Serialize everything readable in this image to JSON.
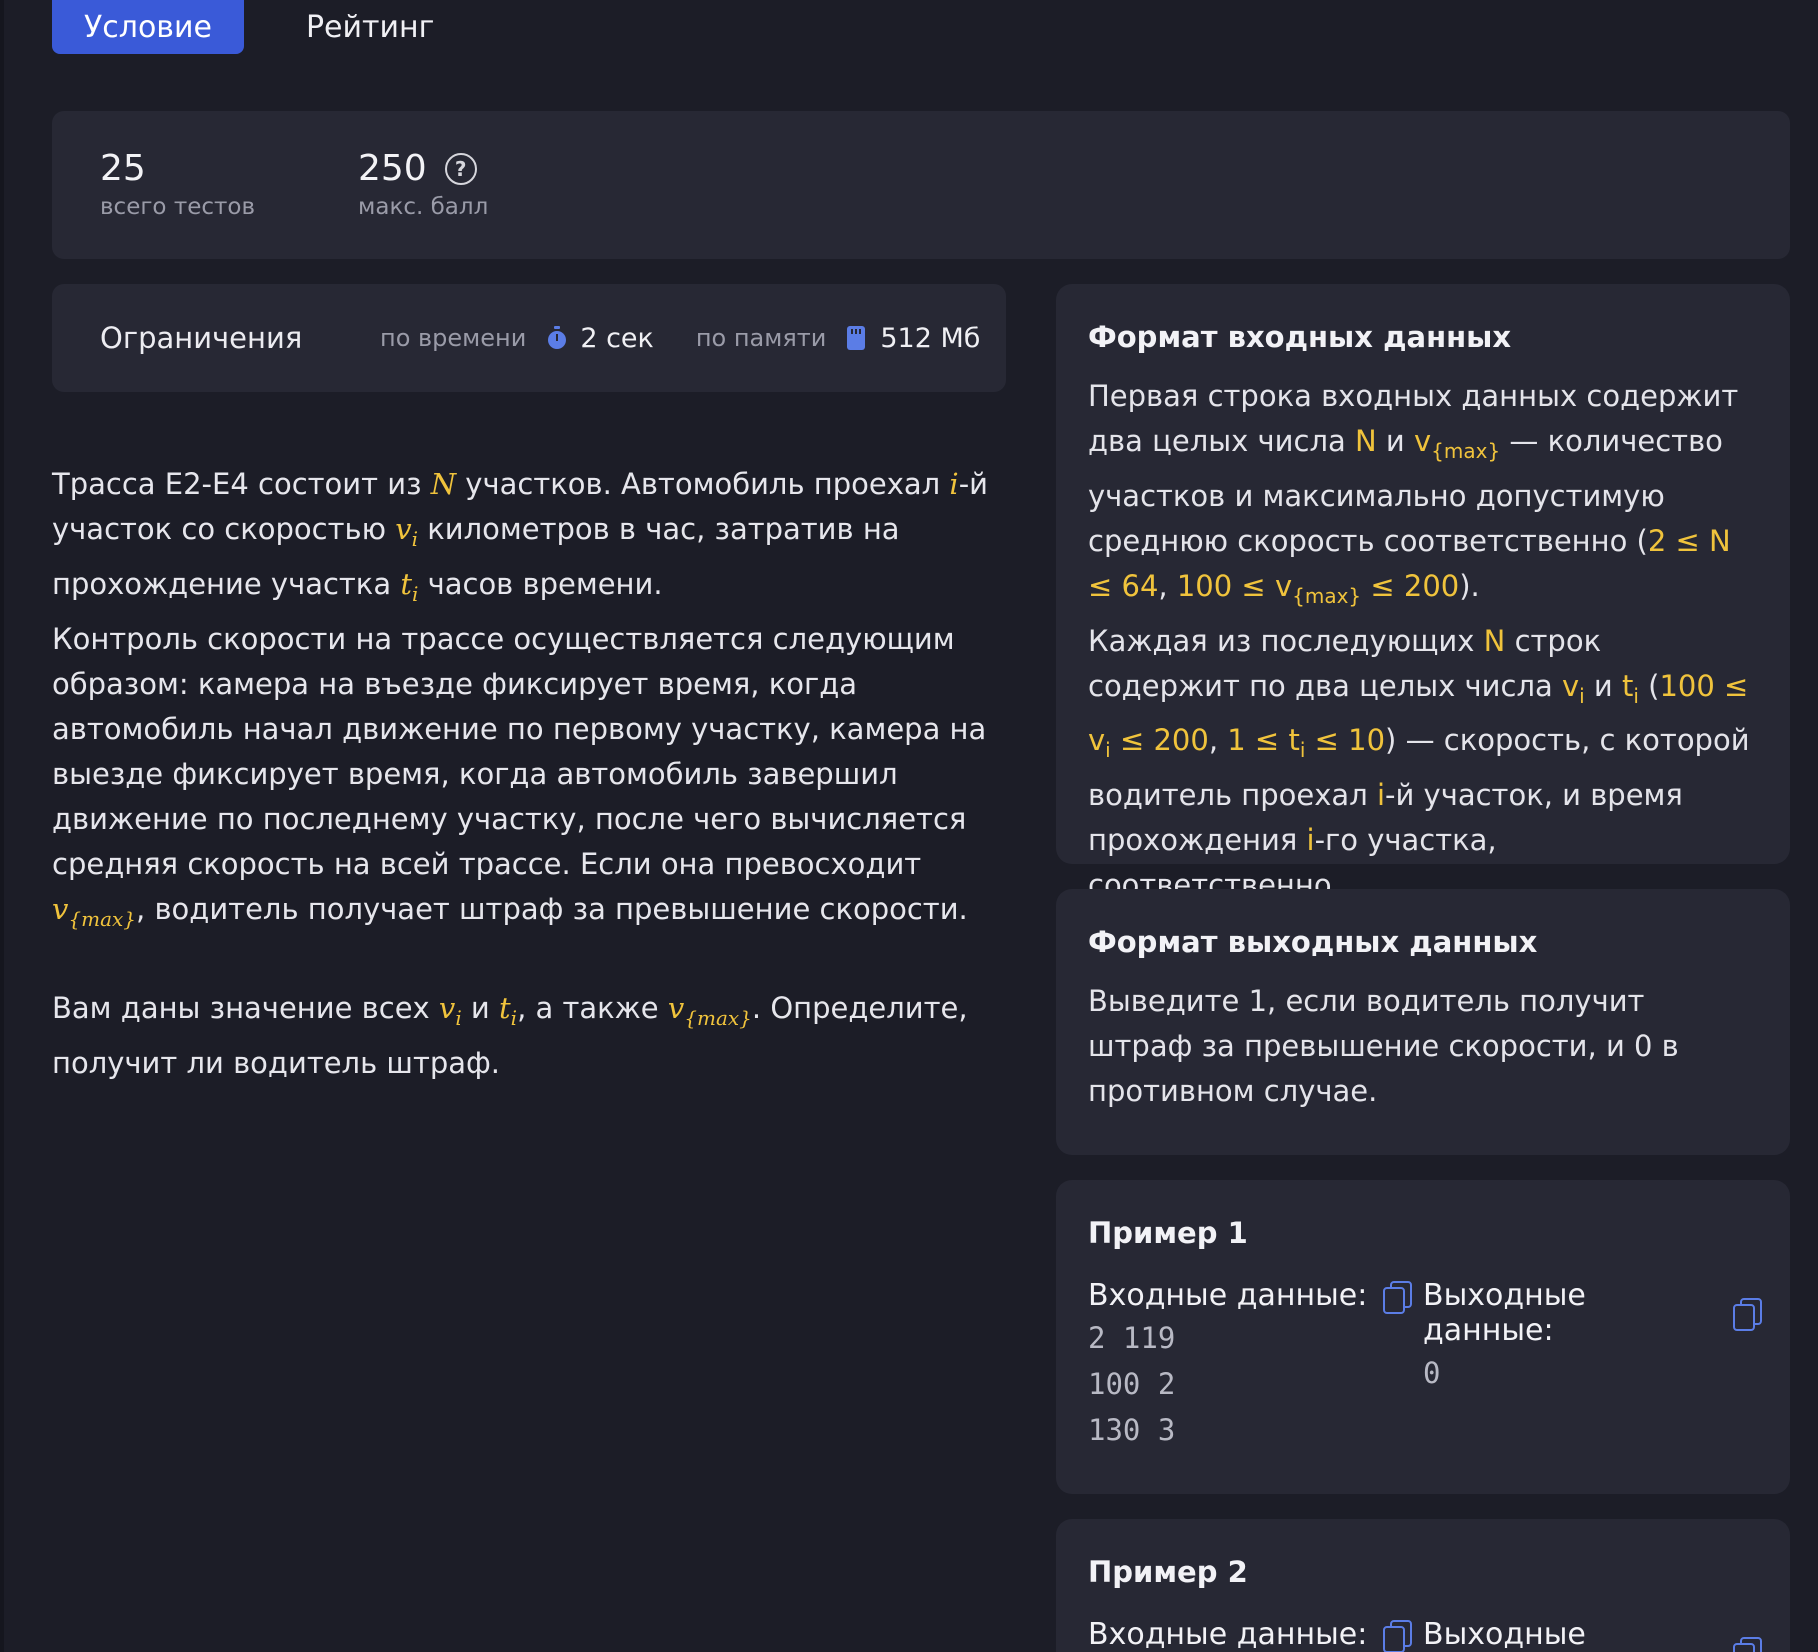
{
  "tabs": {
    "condition": "Условие",
    "rating": "Рейтинг"
  },
  "stats": {
    "tests_value": "25",
    "tests_label": "всего тестов",
    "score_value": "250",
    "score_label": "макс. балл"
  },
  "limits": {
    "title": "Ограничения",
    "time_label": "по времени",
    "time_value": "2 сек",
    "memory_label": "по памяти",
    "memory_value": "512 Мб"
  },
  "statement": {
    "p1_a": "Трасса E2-E4 состоит из ",
    "var_N": "N",
    "p1_b": " участков. Автомобиль проехал ",
    "var_i": "i",
    "p1_c": "-й участок со скоростью ",
    "var_v": "v",
    "sub_i": "i",
    "p1_d": " километров в час, затратив на прохождение участка ",
    "var_t": "t",
    "p1_e": " часов времени.",
    "p2_a": "Контроль скорости на трассе осуществляется следующим образом: камера на въезде фиксирует время, когда автомобиль начал движение по первому участку, камера на выезде фиксирует время, когда автомобиль завершил движение по последнему участку, после чего вычисляется средняя скорость на всей трассе. Если она превосходит ",
    "sub_max": "{max}",
    "p2_b": ", водитель получает штраф за превышение скорости.",
    "p3_a": "Вам даны значение всех ",
    "p3_b": " и ",
    "p3_c": ", а также ",
    "p3_d": ". Определите, получит ли водитель штраф."
  },
  "input_format": {
    "title": "Формат входных данных",
    "s1": "Первая строка входных данных содержит два целых числа ",
    "N": "N",
    "and": " и ",
    "v": "v",
    "sub_max": "{max}",
    "s2": " — количество участков и максимально допустимую среднюю скорость соответственно (",
    "c1": "2 ≤ N ≤ 64",
    "comma": ", ",
    "c2a": "100 ≤ v",
    "c2b": " ≤ 200",
    "s3": ").",
    "s4": "Каждая из последующих ",
    "s5": " строк содержит по два целых числа ",
    "sub_i": "i",
    "t": "t",
    "s6": " (",
    "c3a": "100 ≤ v",
    "c3b": " ≤ 200",
    "c4a": "1 ≤ t",
    "c4b": " ≤ 10",
    "s7": ") — скорость, с которой водитель проехал ",
    "i": "i",
    "s8": "-й участок, и время прохождения ",
    "s9": "-го участка, соответственно."
  },
  "output_format": {
    "title": "Формат выходных данных",
    "text": "Выведите 1, если водитель получит штраф за превышение скорости, и 0 в противном случае."
  },
  "example1": {
    "title": "Пример 1",
    "input_label": "Входные данные:",
    "output_label": "Выходные данные:",
    "input": "2 119\n100 2\n130 3",
    "output": "0"
  },
  "example2": {
    "title": "Пример 2",
    "input_label": "Входные данные:",
    "output_label": "Выходные данные:"
  },
  "colors": {
    "accent": "#3a5ad8",
    "highlight": "#f0c33c",
    "card": "#272834",
    "bg": "#1c1d27"
  },
  "icons": [
    "help-icon",
    "stopwatch-icon",
    "memory-card-icon",
    "copy-icon"
  ]
}
